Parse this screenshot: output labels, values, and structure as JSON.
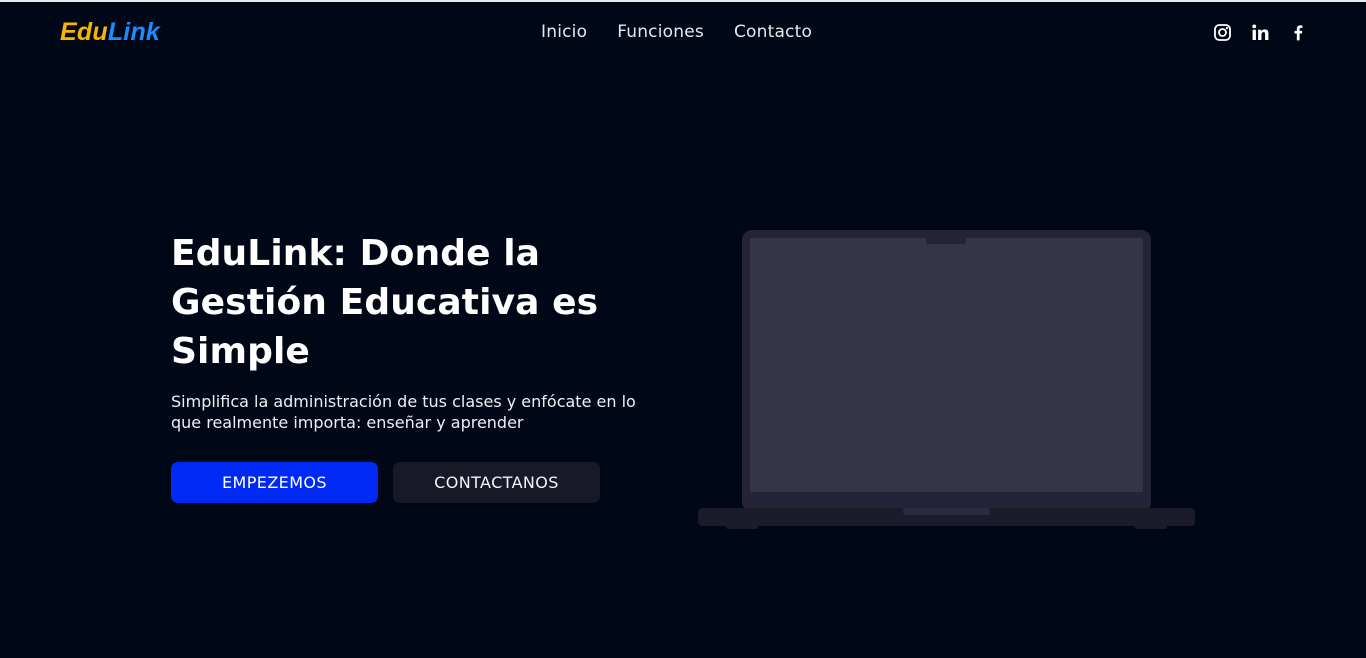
{
  "brand": {
    "name_part1": "Edu",
    "name_part2": "Link",
    "color_part1": "#f7b500",
    "color_part2": "#1c8cff"
  },
  "nav": {
    "items": [
      {
        "label": "Inicio"
      },
      {
        "label": "Funciones"
      },
      {
        "label": "Contacto"
      }
    ]
  },
  "socials": {
    "items": [
      {
        "icon": "instagram-icon"
      },
      {
        "icon": "linkedin-icon"
      },
      {
        "icon": "facebook-icon"
      }
    ]
  },
  "hero": {
    "title": "EduLink: Donde la Gestión Educativa es Simple",
    "subtitle": "Simplifica la administración de tus clases y enfócate en lo que realmente importa: enseñar y aprender",
    "primary_button": "EMPEZEMOS",
    "secondary_button": "CONTACTANOS",
    "image_icon": "laptop-illustration"
  },
  "colors": {
    "background": "#000716",
    "primary_button": "#0029f5",
    "secondary_button": "#171a26",
    "laptop_screen": "#363447",
    "laptop_frame": "#25233a"
  }
}
